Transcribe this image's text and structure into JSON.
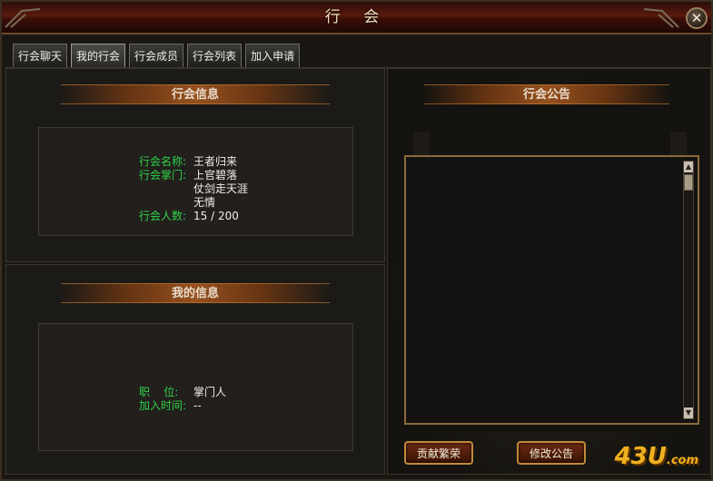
{
  "window": {
    "title": "行 会",
    "close_label": "✕"
  },
  "tabs": [
    {
      "label": "行会聊天"
    },
    {
      "label": "我的行会"
    },
    {
      "label": "行会成员"
    },
    {
      "label": "行会列表"
    },
    {
      "label": "加入申请"
    }
  ],
  "guild_info": {
    "header": "行会信息",
    "name_label": "行会名称:",
    "name_value": "王者归来",
    "leader_label": "行会掌门:",
    "leader_lines": [
      "上官碧落",
      "仗剑走天涯",
      "无情"
    ],
    "members_label": "行会人数:",
    "members_value": "15 / 200"
  },
  "my_info": {
    "header": "我的信息",
    "position_label": "职    位:",
    "position_value": "掌门人",
    "join_time_label": "加入时间:",
    "join_time_value": "--"
  },
  "notice": {
    "header": "行会公告",
    "text": "",
    "contribute_button": "贡献繁荣",
    "edit_button": "修改公告"
  },
  "watermark": {
    "main": "43U",
    "suffix": ".com"
  }
}
